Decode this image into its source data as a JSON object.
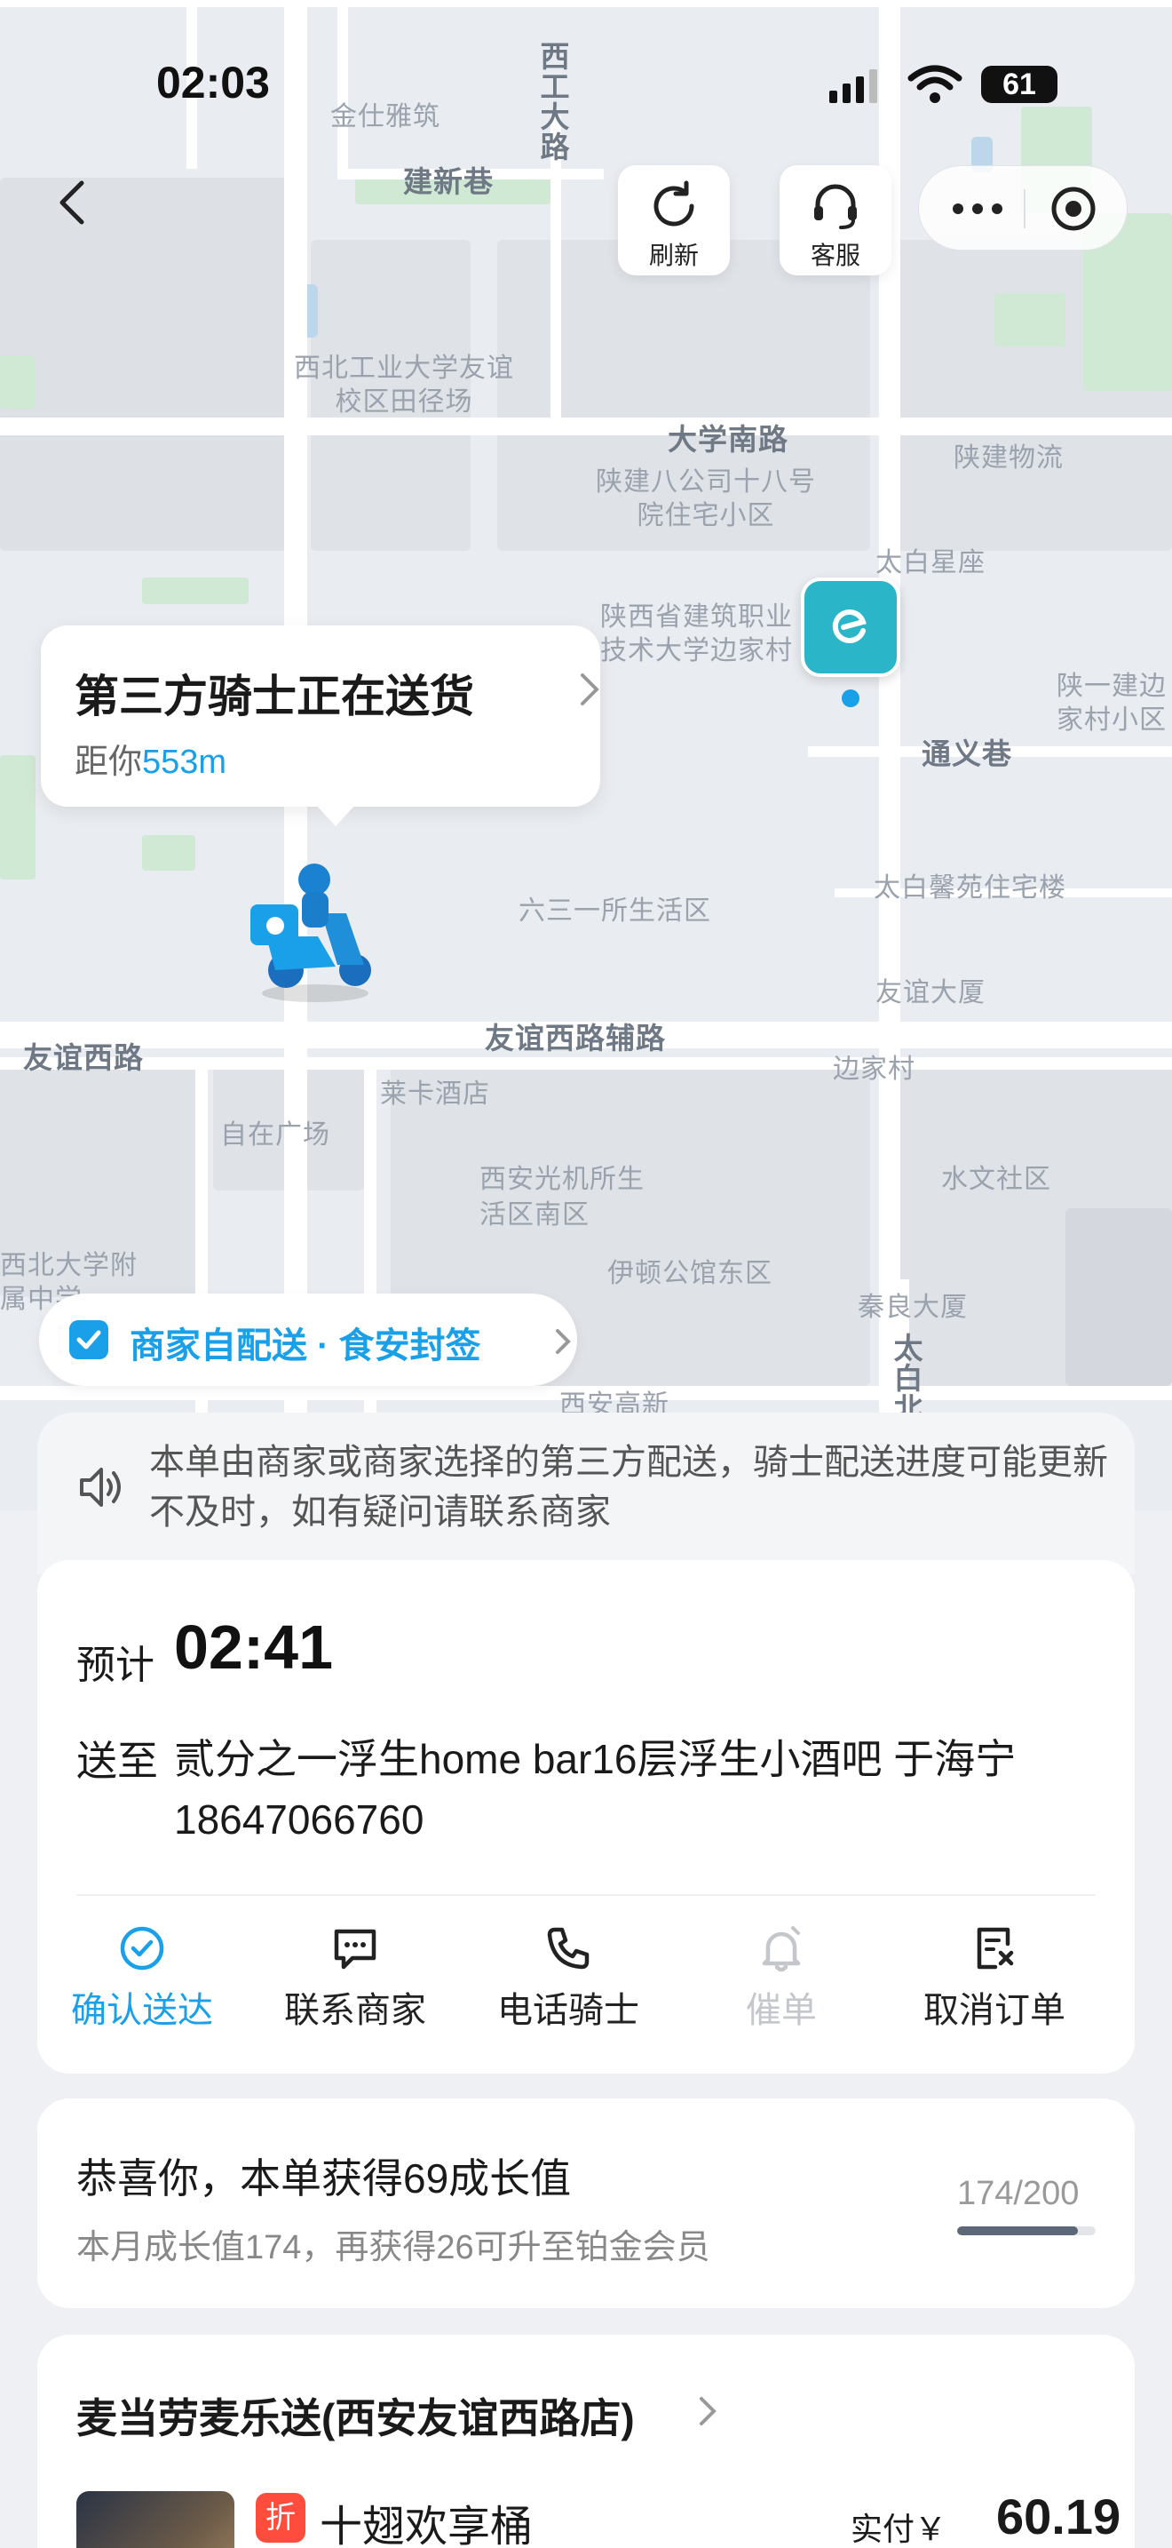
{
  "status_bar": {
    "time": "02:03",
    "battery": "61"
  },
  "nav": {
    "refresh_label": "刷新",
    "service_label": "客服"
  },
  "map": {
    "labels": [
      "西工大路",
      "金仕雅筑",
      "建新巷",
      "西北工业大学友谊校区田径场",
      "大学南路",
      "陕建物流",
      "陕建八公司十八号院住宅小区",
      "太白星座",
      "陕西省建筑职业技术大学边家村校区",
      "陕一建边家村小区",
      "通义巷",
      "六三一所生活区",
      "太白馨苑住宅楼",
      "友谊大厦",
      "友谊西路",
      "友谊西路辅路",
      "边家村",
      "莱卡酒店",
      "自在广场",
      "西安光机所生活区南区",
      "水文社区",
      "伊顿公馆东区",
      "秦良大厦",
      "西安高新",
      "太白北路",
      "西北大学附属中学"
    ]
  },
  "rider": {
    "title": "第三方骑士正在送货",
    "dist_prefix": "距你",
    "dist_value": "553m"
  },
  "badge": {
    "label": "商家自配送 · 食安封签"
  },
  "notice": {
    "text": "本单由商家或商家选择的第三方配送，骑士配送进度可能更新不及时，如有疑问请联系商家"
  },
  "delivery": {
    "eta_label": "预计",
    "eta_time": "02:41",
    "addr_label": "送至",
    "address": "贰分之一浮生home bar16层浮生小酒吧 于海宁 18647066760",
    "actions": [
      {
        "label": "确认送达",
        "icon": "check-circle-icon"
      },
      {
        "label": "联系商家",
        "icon": "chat-icon"
      },
      {
        "label": "电话骑士",
        "icon": "phone-icon"
      },
      {
        "label": "催单",
        "icon": "bell-icon"
      },
      {
        "label": "取消订单",
        "icon": "cancel-order-icon"
      }
    ],
    "colors": {
      "active": "#1aa0e8",
      "disabled": "#c3c6cb"
    }
  },
  "growth": {
    "title": "恭喜你，本单获得69成长值",
    "subtitle": "本月成长值174，再获得26可升至铂金会员",
    "progress_text": "174/200",
    "progress_value": 0.87
  },
  "store": {
    "name": "麦当劳麦乐送(西安友谊西路店)",
    "discount_badge": "折",
    "item_name": "十翅欢享桶",
    "paid_label": "实付￥",
    "paid_amount": "60.19"
  }
}
